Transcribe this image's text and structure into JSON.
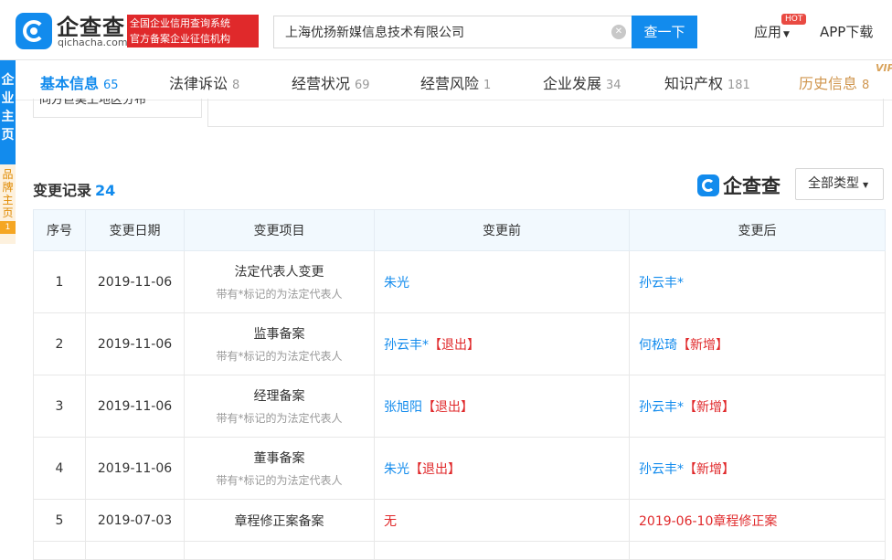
{
  "header": {
    "logo_text": "企查查",
    "logo_domain": "qichacha.com",
    "slogan_line1": "全国企业信用查询系统",
    "slogan_line2": "官方备案企业征信机构",
    "search_value": "上海优扬新媒信息技术有限公司",
    "search_button": "查一下",
    "nav_app": "应用",
    "hot_badge": "HOT",
    "nav_download": "APP下载"
  },
  "side": {
    "main_tab": "企业主页",
    "brand_tab": "品牌主页",
    "brand_count": "1"
  },
  "tabs": [
    {
      "label": "基本信息",
      "count": "65"
    },
    {
      "label": "法律诉讼",
      "count": "8"
    },
    {
      "label": "经营状况",
      "count": "69"
    },
    {
      "label": "经营风险",
      "count": "1"
    },
    {
      "label": "企业发展",
      "count": "34"
    },
    {
      "label": "知识产权",
      "count": "181"
    },
    {
      "label": "历史信息",
      "count": "8"
    }
  ],
  "vip_label": "VIP",
  "prev_text": "同方巨昊上地区分布",
  "section": {
    "title": "变更记录",
    "count": "24",
    "watermark": "企查查",
    "filter_label": "全部类型"
  },
  "table": {
    "headers": [
      "序号",
      "变更日期",
      "变更项目",
      "变更前",
      "变更后"
    ],
    "note": "带有*标记的为法定代表人",
    "tag_out": "【退出】",
    "tag_new": "【新增】",
    "rows": [
      {
        "no": "1",
        "date": "2019-11-06",
        "item": "法定代表人变更",
        "before": "朱光",
        "after": "孙云丰*"
      },
      {
        "no": "2",
        "date": "2019-11-06",
        "item": "监事备案",
        "before": "孙云丰*",
        "after": "何松琦"
      },
      {
        "no": "3",
        "date": "2019-11-06",
        "item": "经理备案",
        "before": "张旭阳",
        "after": "孙云丰*"
      },
      {
        "no": "4",
        "date": "2019-11-06",
        "item": "董事备案",
        "before": "朱光",
        "after": "孙云丰*"
      },
      {
        "no": "5",
        "date": "2019-07-03",
        "item": "章程修正案备案",
        "before": "无",
        "after": "2019-06-10章程修正案"
      }
    ]
  }
}
